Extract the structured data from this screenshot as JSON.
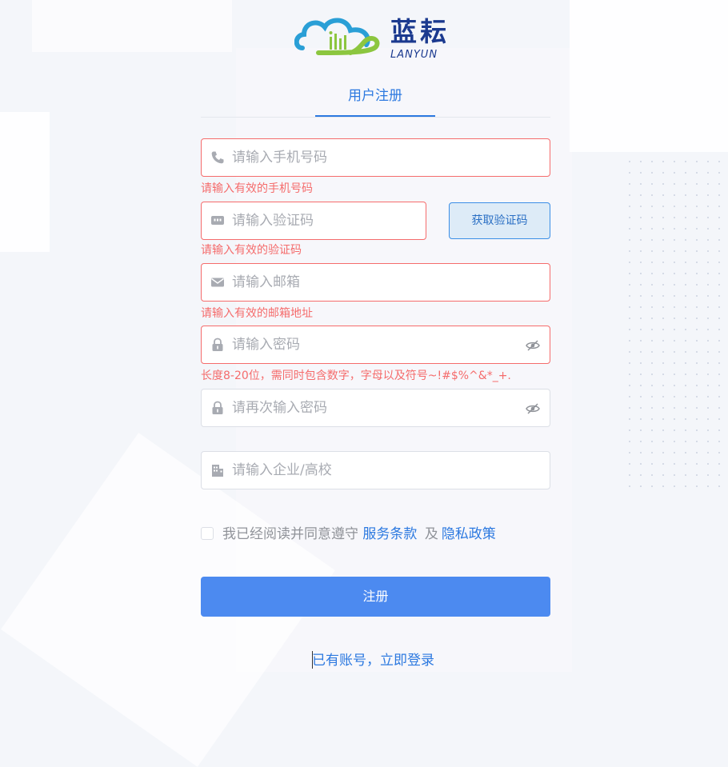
{
  "brand": {
    "name_cn": "蓝耘",
    "name_en": "LANYUN",
    "colors": {
      "blue": "#1b3a8f",
      "green": "#8cc63f",
      "teal": "#2a9fd6"
    }
  },
  "tabs": {
    "active": "用户注册"
  },
  "form": {
    "phone": {
      "placeholder": "请输入手机号码",
      "value": "",
      "error": "请输入有效的手机号码",
      "icon": "phone-icon"
    },
    "code": {
      "placeholder": "请输入验证码",
      "value": "",
      "error": "请输入有效的验证码",
      "icon": "message-icon",
      "button_label": "获取验证码"
    },
    "email": {
      "placeholder": "请输入邮箱",
      "value": "",
      "error": "请输入有效的邮箱地址",
      "icon": "mail-icon"
    },
    "password": {
      "placeholder": "请输入密码",
      "value": "",
      "error": "长度8-20位，需同时包含数字，字母以及符号~!#$%^&*_+.",
      "icon": "lock-icon",
      "toggle_icon": "eye-hidden-icon"
    },
    "confirm_password": {
      "placeholder": "请再次输入密码",
      "value": "",
      "icon": "lock-icon",
      "toggle_icon": "eye-hidden-icon"
    },
    "organization": {
      "placeholder": "请输入企业/高校",
      "value": "",
      "icon": "building-icon"
    }
  },
  "agreement": {
    "checked": false,
    "prefix": "我已经阅读并同意遵守",
    "terms_label": "服务条款",
    "connector": "及",
    "privacy_label": "隐私政策"
  },
  "submit_label": "注册",
  "login_link": "已有账号，立即登录",
  "colors": {
    "primary": "#4c8af0",
    "error": "#f56c6c",
    "link": "#2c79e0"
  }
}
